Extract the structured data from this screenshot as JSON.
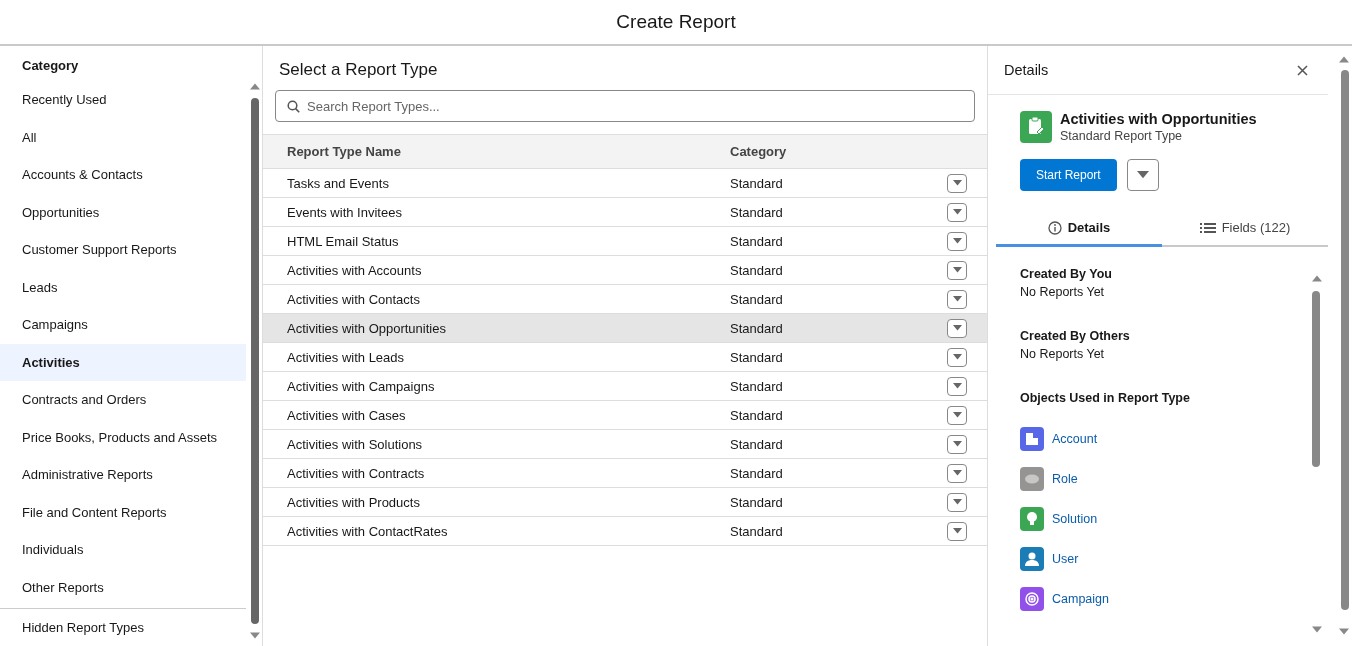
{
  "window": {
    "title": "Create Report"
  },
  "sidebar": {
    "heading": "Category",
    "items": [
      {
        "label": "Recently Used",
        "selected": false
      },
      {
        "label": "All",
        "selected": false
      },
      {
        "label": "Accounts & Contacts",
        "selected": false
      },
      {
        "label": "Opportunities",
        "selected": false
      },
      {
        "label": "Customer Support Reports",
        "selected": false
      },
      {
        "label": "Leads",
        "selected": false
      },
      {
        "label": "Campaigns",
        "selected": false
      },
      {
        "label": "Activities",
        "selected": true
      },
      {
        "label": "Contracts and Orders",
        "selected": false
      },
      {
        "label": "Price Books, Products and Assets",
        "selected": false
      },
      {
        "label": "Administrative Reports",
        "selected": false
      },
      {
        "label": "File and Content Reports",
        "selected": false
      },
      {
        "label": "Individuals",
        "selected": false
      },
      {
        "label": "Other Reports",
        "selected": false
      }
    ],
    "footer_item": {
      "label": "Hidden Report Types",
      "selected": false
    }
  },
  "main": {
    "title": "Select a Report Type",
    "search": {
      "placeholder": "Search Report Types..."
    },
    "table": {
      "columns": [
        "Report Type Name",
        "Category"
      ],
      "rows": [
        {
          "name": "Tasks and Events",
          "category": "Standard",
          "selected": false
        },
        {
          "name": "Events with Invitees",
          "category": "Standard",
          "selected": false
        },
        {
          "name": "HTML Email Status",
          "category": "Standard",
          "selected": false
        },
        {
          "name": "Activities with Accounts",
          "category": "Standard",
          "selected": false
        },
        {
          "name": "Activities with Contacts",
          "category": "Standard",
          "selected": false
        },
        {
          "name": "Activities with Opportunities",
          "category": "Standard",
          "selected": true
        },
        {
          "name": "Activities with Leads",
          "category": "Standard",
          "selected": false
        },
        {
          "name": "Activities with Campaigns",
          "category": "Standard",
          "selected": false
        },
        {
          "name": "Activities with Cases",
          "category": "Standard",
          "selected": false
        },
        {
          "name": "Activities with Solutions",
          "category": "Standard",
          "selected": false
        },
        {
          "name": "Activities with Contracts",
          "category": "Standard",
          "selected": false
        },
        {
          "name": "Activities with Products",
          "category": "Standard",
          "selected": false
        },
        {
          "name": "Activities with ContactRates",
          "category": "Standard",
          "selected": false
        }
      ]
    }
  },
  "details": {
    "title": "Details",
    "report_name": "Activities with Opportunities",
    "report_kind": "Standard Report Type",
    "start_button": "Start Report",
    "tabs": [
      {
        "label": "Details",
        "kind": "info",
        "selected": true
      },
      {
        "label": "Fields (122)",
        "kind": "list",
        "selected": false
      }
    ],
    "sections": [
      {
        "heading": "Created By You",
        "text": "No Reports Yet"
      },
      {
        "heading": "Created By Others",
        "text": "No Reports Yet"
      }
    ],
    "objects_heading": "Objects Used in Report Type",
    "objects": [
      {
        "label": "Account",
        "kind": "building",
        "color": "#5867e8"
      },
      {
        "label": "Role",
        "kind": "cloud",
        "color": "#969492"
      },
      {
        "label": "Solution",
        "kind": "bulb",
        "color": "#3ba755"
      },
      {
        "label": "User",
        "kind": "person",
        "color": "#1b7cb6"
      },
      {
        "label": "Campaign",
        "kind": "target",
        "color": "#9050e9"
      }
    ]
  }
}
